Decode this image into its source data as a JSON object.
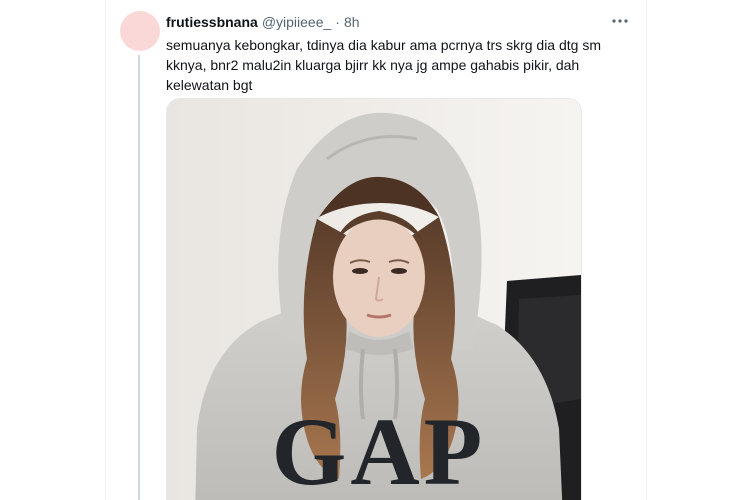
{
  "tweet": {
    "display_name": "frutiessbnana",
    "handle": "@yipiieee_",
    "separator": "·",
    "timestamp": "8h",
    "text": "semuanya kebongkar, tdinya dia kabur ama pcrnya trs skrg dia dtg sm\nkknya, bnr2 malu2in kluarga bjirr kk nya jg ampe gahabis pikir, dah\nkelewatan bgt",
    "media_text": "GAP"
  },
  "icons": {
    "more": "more-horizontal-icon"
  },
  "colors": {
    "avatar": "#fad8d8",
    "text_primary": "#0f1419",
    "text_secondary": "#536471",
    "hoodie": "#c9c7c3",
    "hair": "#9a6b47"
  }
}
